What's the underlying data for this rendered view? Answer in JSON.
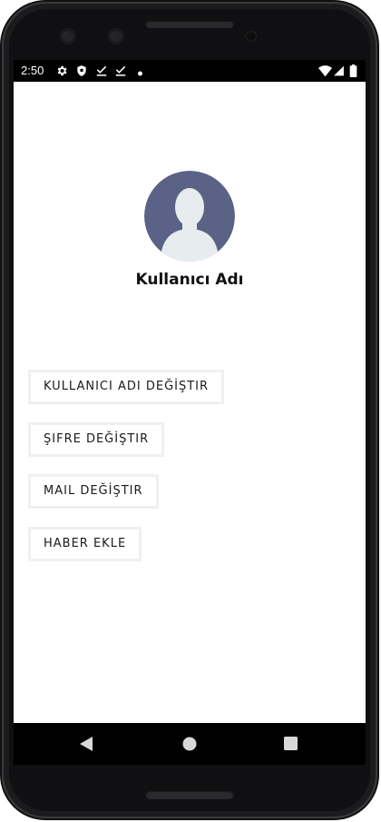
{
  "status_bar": {
    "time": "2:50",
    "left_icons": [
      "settings-icon",
      "shield-icon",
      "download-check-icon",
      "download-check-icon",
      "dot-icon"
    ],
    "right_icons": [
      "wifi-icon",
      "signal-icon",
      "battery-icon"
    ]
  },
  "profile": {
    "avatar": "default-user-avatar",
    "avatar_color": "#5a6386",
    "username": "Kullanıcı Adı"
  },
  "actions": [
    {
      "label": "KULLANICI ADI DEĞİŞTIR"
    },
    {
      "label": "ŞIFRE DEĞİŞTIR"
    },
    {
      "label": "MAIL DEĞİŞTIR"
    },
    {
      "label": "HABER EKLE"
    }
  ],
  "nav_bar": {
    "icons": [
      "back-icon",
      "home-icon",
      "recents-icon"
    ]
  }
}
